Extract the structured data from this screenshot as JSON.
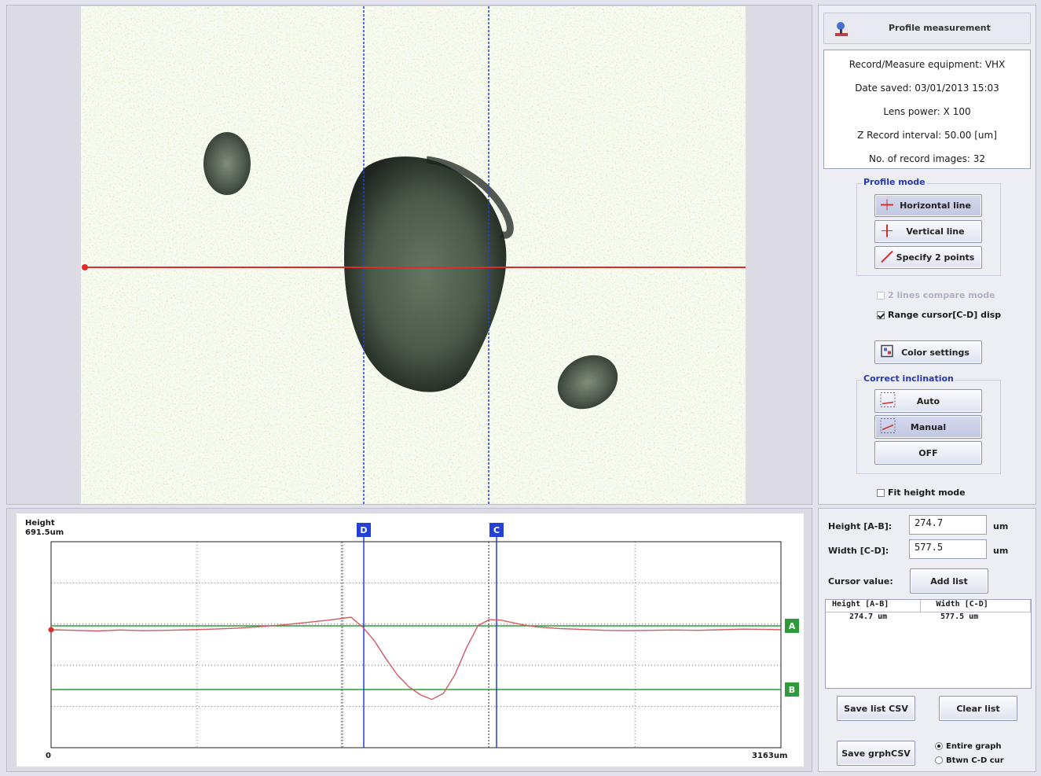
{
  "header": {
    "title": "Profile measurement",
    "logo_icon": "microscope-icon"
  },
  "info": {
    "equipment": "Record/Measure equipment: VHX",
    "date_saved": "Date saved: 03/01/2013 15:03",
    "lens_power": "Lens power: X 100",
    "z_interval": "Z Record interval: 50.00 [um]",
    "record_images": "No. of record images: 32"
  },
  "profile_mode": {
    "label": "Profile mode",
    "horizontal": "Horizontal line",
    "vertical": "Vertical line",
    "two_points": "Specify 2 points",
    "selected": "Horizontal line"
  },
  "options": {
    "two_lines_compare": "2 lines compare mode",
    "range_cursor": "Range cursor[C-D] disp",
    "color_settings": "Color settings",
    "fit_height": "Fit height mode"
  },
  "correct_inclination": {
    "label": "Correct inclination",
    "auto": "Auto",
    "manual": "Manual",
    "off": "OFF",
    "selected": "Manual"
  },
  "measure": {
    "height_label": "Height [A-B]:",
    "height_value": "274.7",
    "width_label": "Width [C-D]:",
    "width_value": "577.5",
    "unit": "um",
    "cursor_label": "Cursor value:",
    "add_list": "Add list"
  },
  "list": {
    "header_height": "Height [A-B]",
    "header_width": "Width [C-D]",
    "rows": [
      {
        "height": "274.7 um",
        "width": "577.5 um"
      }
    ]
  },
  "buttons": {
    "save_list": "Save list CSV",
    "clear_list": "Clear list",
    "save_graph": "Save grphCSV",
    "entire_graph": "Entire graph",
    "btwn_cd": "Btwn C-D cur"
  },
  "graph": {
    "y_label": "Height",
    "y_max": "691.5um",
    "x_min": "0",
    "x_max": "3163um",
    "marker_a": "A",
    "marker_b": "B",
    "marker_c": "C",
    "marker_d": "D",
    "profile_color": "#d25a63",
    "cursor_color": "#2340d8",
    "ref_color": "#2f9a3a"
  },
  "chart_data": {
    "type": "line",
    "xlabel": "",
    "ylabel": "Height",
    "xlim": [
      0,
      3163
    ],
    "ylim": [
      0,
      691.5
    ],
    "series": [
      {
        "x": [
          0,
          100,
          200,
          300,
          400,
          500,
          600,
          700,
          800,
          900,
          1000,
          1100,
          1200,
          1300,
          1350,
          1400,
          1450,
          1500,
          1550,
          1600,
          1650,
          1700,
          1750,
          1800,
          1850,
          1900,
          1950,
          2000,
          2050,
          2100,
          2200,
          2300,
          2400,
          2500,
          2600,
          2700,
          2800,
          2900,
          3000,
          3100,
          3163
        ],
        "y": [
          396,
          394,
          392,
          395,
          393,
          394,
          396,
          398,
          401,
          406,
          412,
          420,
          428,
          438,
          405,
          360,
          300,
          245,
          205,
          178,
          162,
          182,
          245,
          335,
          410,
          430,
          428,
          420,
          412,
          406,
          400,
          397,
          394,
          393,
          394,
          395,
          394,
          396,
          398,
          397,
          396
        ]
      }
    ]
  }
}
